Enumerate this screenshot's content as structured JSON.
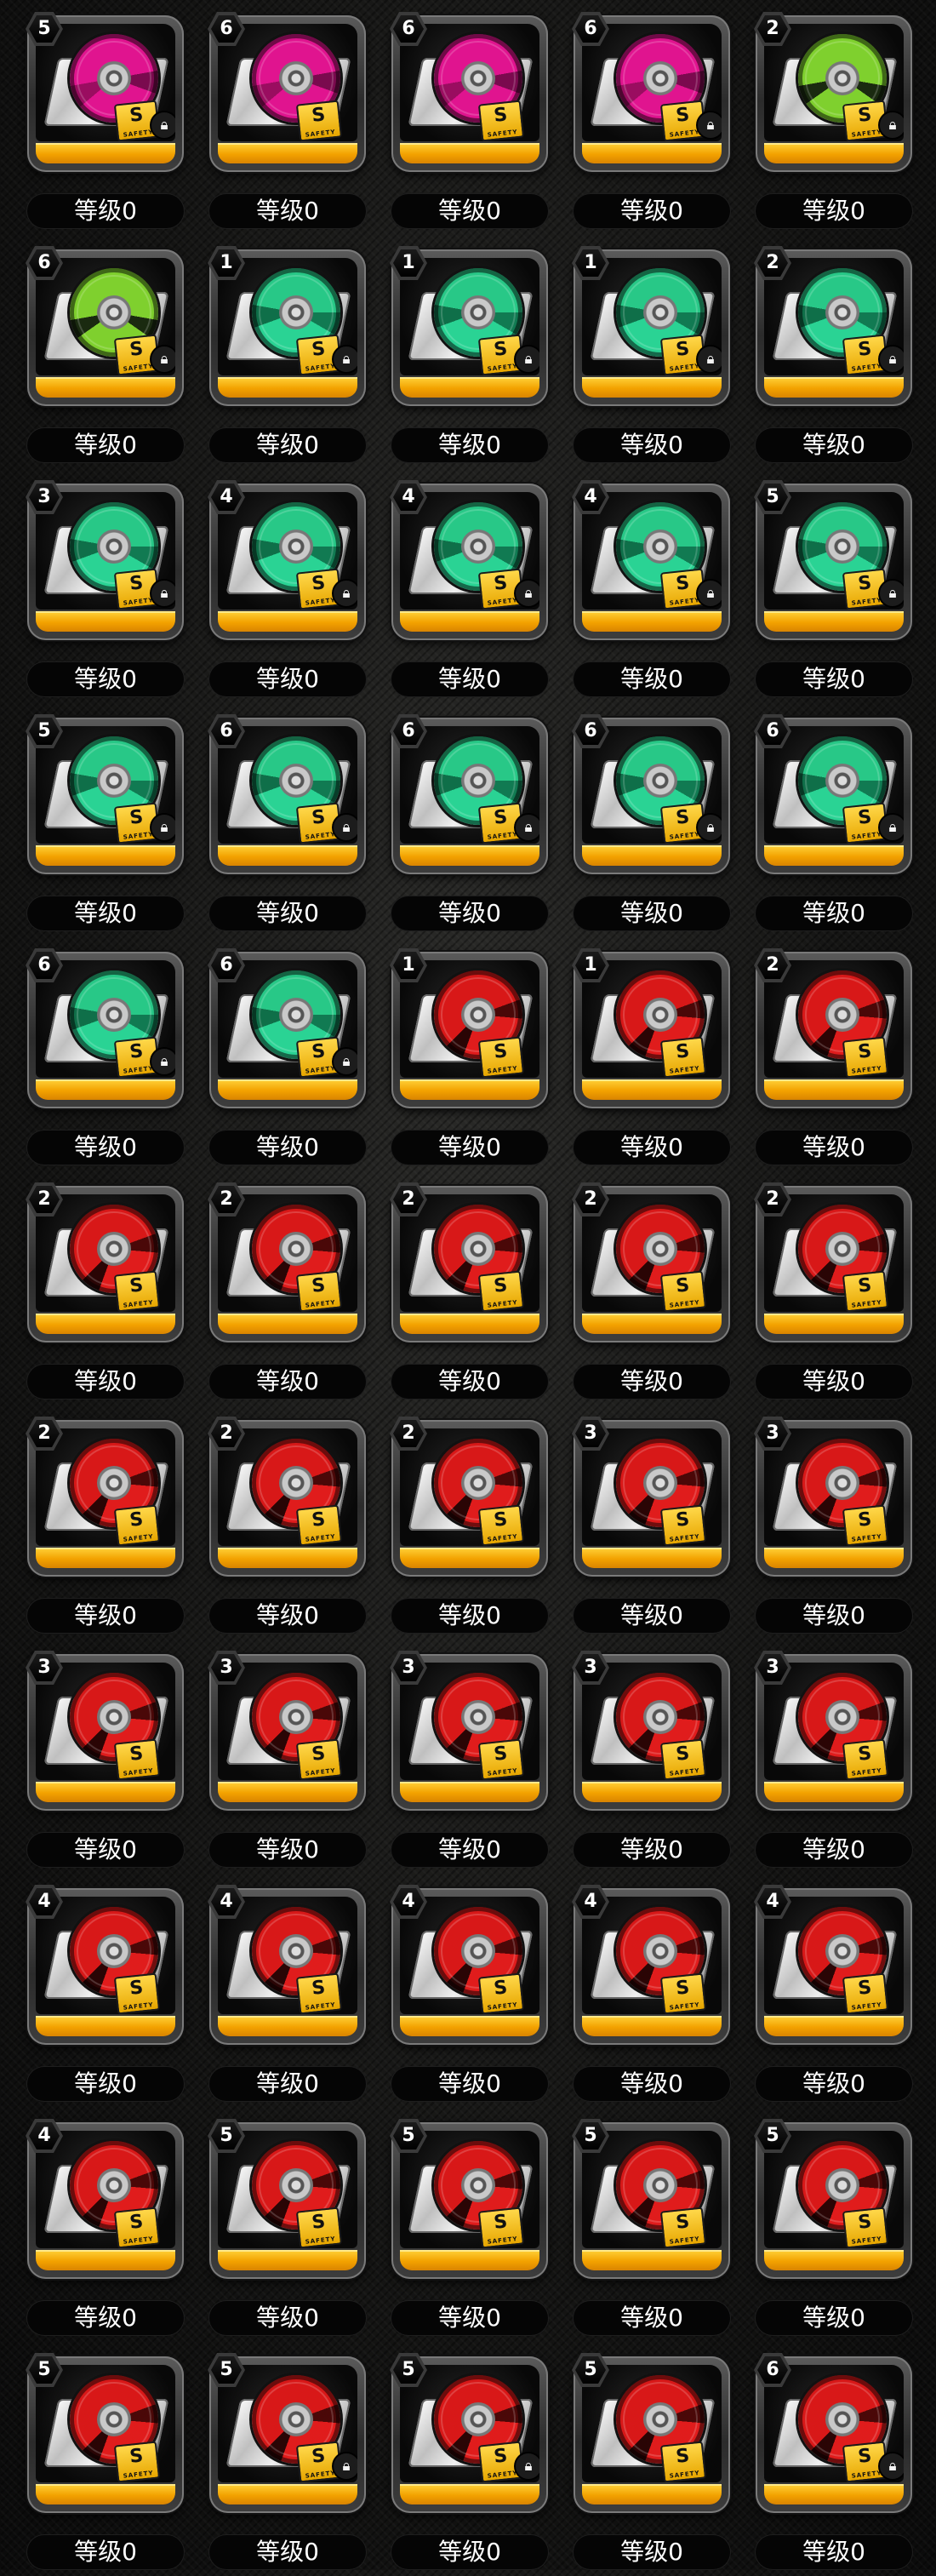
{
  "level_label": "等级0",
  "colors": {
    "magenta": "#e0148f",
    "lime": "#7fd02e",
    "green": "#28c887",
    "red": "#d81818",
    "bar_yellow": "#f3a200"
  },
  "icons": {
    "lock": "lock-icon",
    "disc": "disc-icon",
    "sticker": "rank-sticker-icon"
  },
  "sticker": {
    "letter": "S",
    "text": "SAFETY"
  },
  "items": [
    {
      "rank": "5",
      "color": "magenta",
      "locked": true
    },
    {
      "rank": "6",
      "color": "magenta",
      "locked": false
    },
    {
      "rank": "6",
      "color": "magenta",
      "locked": false
    },
    {
      "rank": "6",
      "color": "magenta",
      "locked": true
    },
    {
      "rank": "2",
      "color": "lime",
      "locked": true
    },
    {
      "rank": "6",
      "color": "lime",
      "locked": true
    },
    {
      "rank": "1",
      "color": "green",
      "locked": true
    },
    {
      "rank": "1",
      "color": "green",
      "locked": true
    },
    {
      "rank": "1",
      "color": "green",
      "locked": true
    },
    {
      "rank": "2",
      "color": "green",
      "locked": true
    },
    {
      "rank": "3",
      "color": "green",
      "locked": true
    },
    {
      "rank": "4",
      "color": "green",
      "locked": true
    },
    {
      "rank": "4",
      "color": "green",
      "locked": true
    },
    {
      "rank": "4",
      "color": "green",
      "locked": true
    },
    {
      "rank": "5",
      "color": "green",
      "locked": true
    },
    {
      "rank": "5",
      "color": "green",
      "locked": true
    },
    {
      "rank": "6",
      "color": "green",
      "locked": true
    },
    {
      "rank": "6",
      "color": "green",
      "locked": true
    },
    {
      "rank": "6",
      "color": "green",
      "locked": true
    },
    {
      "rank": "6",
      "color": "green",
      "locked": true
    },
    {
      "rank": "6",
      "color": "green",
      "locked": true
    },
    {
      "rank": "6",
      "color": "green",
      "locked": true
    },
    {
      "rank": "1",
      "color": "red",
      "locked": false
    },
    {
      "rank": "1",
      "color": "red",
      "locked": false
    },
    {
      "rank": "2",
      "color": "red",
      "locked": false
    },
    {
      "rank": "2",
      "color": "red",
      "locked": false
    },
    {
      "rank": "2",
      "color": "red",
      "locked": false
    },
    {
      "rank": "2",
      "color": "red",
      "locked": false
    },
    {
      "rank": "2",
      "color": "red",
      "locked": false
    },
    {
      "rank": "2",
      "color": "red",
      "locked": false
    },
    {
      "rank": "2",
      "color": "red",
      "locked": false
    },
    {
      "rank": "2",
      "color": "red",
      "locked": false
    },
    {
      "rank": "2",
      "color": "red",
      "locked": false
    },
    {
      "rank": "3",
      "color": "red",
      "locked": false
    },
    {
      "rank": "3",
      "color": "red",
      "locked": false
    },
    {
      "rank": "3",
      "color": "red",
      "locked": false
    },
    {
      "rank": "3",
      "color": "red",
      "locked": false
    },
    {
      "rank": "3",
      "color": "red",
      "locked": false
    },
    {
      "rank": "3",
      "color": "red",
      "locked": false
    },
    {
      "rank": "3",
      "color": "red",
      "locked": false
    },
    {
      "rank": "4",
      "color": "red",
      "locked": false
    },
    {
      "rank": "4",
      "color": "red",
      "locked": false
    },
    {
      "rank": "4",
      "color": "red",
      "locked": false
    },
    {
      "rank": "4",
      "color": "red",
      "locked": false
    },
    {
      "rank": "4",
      "color": "red",
      "locked": false
    },
    {
      "rank": "4",
      "color": "red",
      "locked": false
    },
    {
      "rank": "5",
      "color": "red",
      "locked": false
    },
    {
      "rank": "5",
      "color": "red",
      "locked": false
    },
    {
      "rank": "5",
      "color": "red",
      "locked": false
    },
    {
      "rank": "5",
      "color": "red",
      "locked": false
    },
    {
      "rank": "5",
      "color": "red",
      "locked": false
    },
    {
      "rank": "5",
      "color": "red",
      "locked": true
    },
    {
      "rank": "5",
      "color": "red",
      "locked": true
    },
    {
      "rank": "5",
      "color": "red",
      "locked": false
    },
    {
      "rank": "6",
      "color": "red",
      "locked": true
    }
  ]
}
